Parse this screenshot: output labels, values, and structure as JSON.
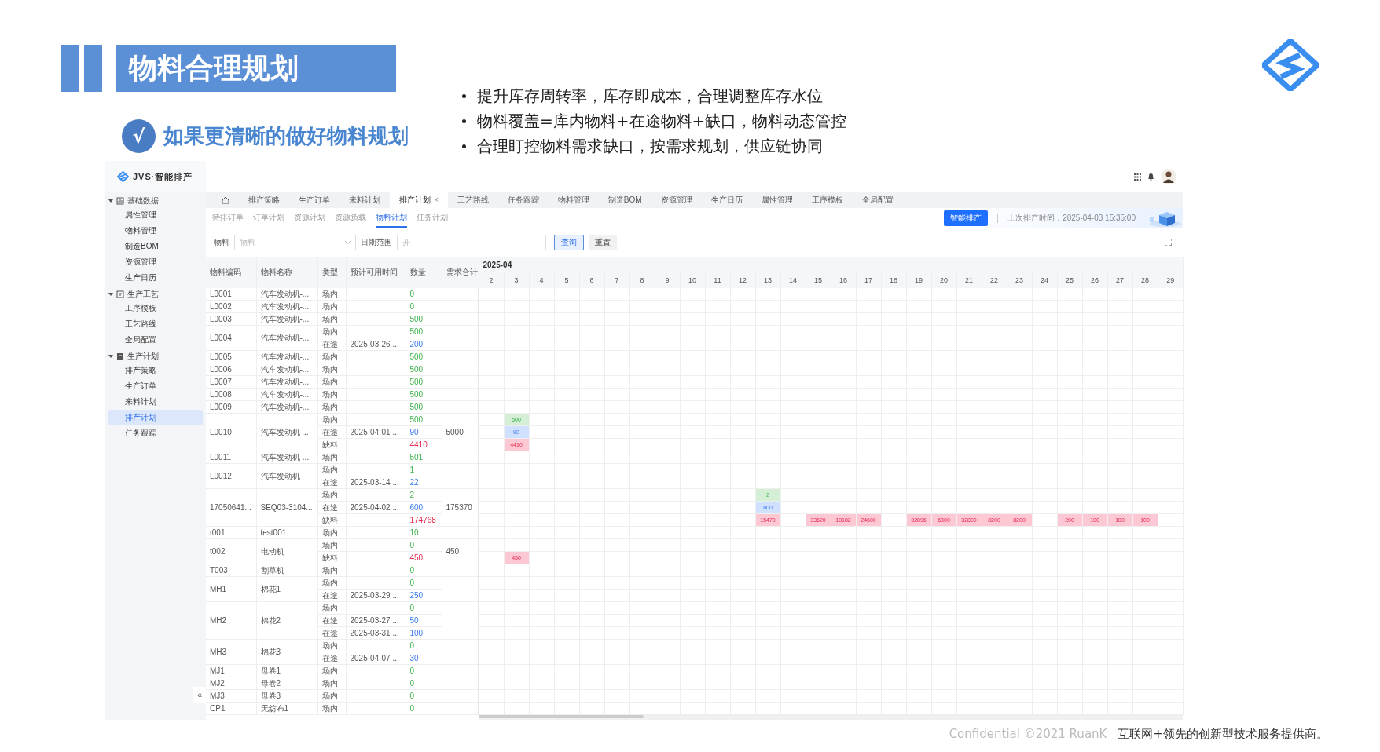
{
  "slide": {
    "title": "物料合理规划",
    "check": "√",
    "subtitle": "如果更清晰的做好物料规划",
    "bullets": [
      "提升库存周转率，库存即成本，合理调整库存水位",
      "物料覆盖=库内物料+在途物料+缺口，物料动态管控",
      "合理盯控物料需求缺口，按需求规划，供应链协同"
    ],
    "footer": {
      "confidential": "Confidential ©2021 RuanK",
      "tagline": "互联网+领先的创新型技术服务提供商。"
    }
  },
  "app": {
    "sidebar": {
      "brand": "JVS·智能排产",
      "collapse": "«",
      "groups": [
        {
          "label": "基础数据",
          "expanded": true,
          "items": [
            {
              "label": "属性管理",
              "selected": false
            },
            {
              "label": "物料管理",
              "selected": false
            },
            {
              "label": "制造BOM",
              "selected": false
            },
            {
              "label": "资源管理",
              "selected": false
            },
            {
              "label": "生产日历",
              "selected": false
            }
          ]
        },
        {
          "label": "生产工艺",
          "expanded": true,
          "items": [
            {
              "label": "工序模板",
              "selected": false
            },
            {
              "label": "工艺路线",
              "selected": false
            },
            {
              "label": "全局配置",
              "selected": false
            }
          ]
        },
        {
          "label": "生产计划",
          "expanded": true,
          "items": [
            {
              "label": "排产策略",
              "selected": false
            },
            {
              "label": "生产订单",
              "selected": false
            },
            {
              "label": "来料计划",
              "selected": false
            },
            {
              "label": "排产计划",
              "selected": true
            },
            {
              "label": "任务跟踪",
              "selected": false
            }
          ]
        }
      ]
    },
    "tabs": [
      {
        "label": "排产策略",
        "selected": false
      },
      {
        "label": "生产订单",
        "selected": false
      },
      {
        "label": "来料计划",
        "selected": false
      },
      {
        "label": "排产计划",
        "selected": true,
        "close": "×"
      },
      {
        "label": "工艺路线",
        "selected": false
      },
      {
        "label": "任务跟踪",
        "selected": false
      },
      {
        "label": "物料管理",
        "selected": false
      },
      {
        "label": "制造BOM",
        "selected": false
      },
      {
        "label": "资源管理",
        "selected": false
      },
      {
        "label": "生产日历",
        "selected": false
      },
      {
        "label": "属性管理",
        "selected": false
      },
      {
        "label": "工序模板",
        "selected": false
      },
      {
        "label": "全局配置",
        "selected": false
      }
    ],
    "subtabs": [
      {
        "label": "待排订单",
        "selected": false
      },
      {
        "label": "订单计划",
        "selected": false
      },
      {
        "label": "资源计划",
        "selected": false
      },
      {
        "label": "资源负载",
        "selected": false
      },
      {
        "label": "物料计划",
        "selected": true
      },
      {
        "label": "任务计划",
        "selected": false
      }
    ],
    "action_button": "智能排产",
    "last_run": "上次排产时间：2025-04-03 15:35:00",
    "filters": {
      "material_label": "物料",
      "material_placeholder": "物料",
      "date_label": "日期范围",
      "date_placeholder": "开",
      "date_separator": "-",
      "query_button": "查询",
      "reset_button": "重置"
    },
    "table": {
      "columns": [
        "物料编码",
        "物料名称",
        "类型",
        "预计可用时间",
        "数量",
        "需求合计"
      ],
      "month": "2025-04",
      "days": [
        "2",
        "3",
        "4",
        "5",
        "6",
        "7",
        "8",
        "9",
        "10",
        "11",
        "12",
        "13",
        "14",
        "15",
        "16",
        "17",
        "18",
        "19",
        "20",
        "21",
        "22",
        "23",
        "24",
        "25",
        "26",
        "27",
        "28",
        "29"
      ],
      "rows": [
        {
          "code": "L0001",
          "name": "汽车发动机-...",
          "entries": [
            {
              "type": "场内",
              "kind": "onsite",
              "qty": "0"
            }
          ]
        },
        {
          "code": "L0002",
          "name": "汽车发动机-...",
          "entries": [
            {
              "type": "场内",
              "kind": "onsite",
              "qty": "0"
            }
          ]
        },
        {
          "code": "L0003",
          "name": "汽车发动机-...",
          "entries": [
            {
              "type": "场内",
              "kind": "onsite",
              "qty": "500"
            }
          ]
        },
        {
          "code": "L0004",
          "name": "汽车发动机-...",
          "entries": [
            {
              "type": "场内",
              "kind": "onsite",
              "qty": "500"
            },
            {
              "type": "在途",
              "kind": "transit",
              "time": "2025-03-26 ...",
              "qty": "200"
            }
          ]
        },
        {
          "code": "L0005",
          "name": "汽车发动机-...",
          "entries": [
            {
              "type": "场内",
              "kind": "onsite",
              "qty": "500"
            }
          ]
        },
        {
          "code": "L0006",
          "name": "汽车发动机-...",
          "entries": [
            {
              "type": "场内",
              "kind": "onsite",
              "qty": "500"
            }
          ]
        },
        {
          "code": "L0007",
          "name": "汽车发动机-...",
          "entries": [
            {
              "type": "场内",
              "kind": "onsite",
              "qty": "500"
            }
          ]
        },
        {
          "code": "L0008",
          "name": "汽车发动机-...",
          "entries": [
            {
              "type": "场内",
              "kind": "onsite",
              "qty": "500"
            }
          ]
        },
        {
          "code": "L0009",
          "name": "汽车发动机-...",
          "entries": [
            {
              "type": "场内",
              "kind": "onsite",
              "qty": "500"
            }
          ]
        },
        {
          "code": "L0010",
          "name": "汽车发动机 ...",
          "demand": "5000",
          "entries": [
            {
              "type": "场内",
              "kind": "onsite",
              "qty": "500",
              "cells": [
                null,
                "500",
                null,
                null,
                null,
                null,
                null,
                null,
                null,
                null,
                null,
                null,
                null,
                null,
                null,
                null,
                null,
                null,
                null,
                null,
                null,
                null,
                null,
                null,
                null,
                null,
                null,
                null
              ]
            },
            {
              "type": "在途",
              "kind": "transit",
              "time": "2025-04-01 ...",
              "qty": "90",
              "cells": [
                null,
                "90",
                null,
                null,
                null,
                null,
                null,
                null,
                null,
                null,
                null,
                null,
                null,
                null,
                null,
                null,
                null,
                null,
                null,
                null,
                null,
                null,
                null,
                null,
                null,
                null,
                null,
                null
              ]
            },
            {
              "type": "缺料",
              "kind": "shortage",
              "qty": "4410",
              "cells": [
                null,
                "4410",
                null,
                null,
                null,
                null,
                null,
                null,
                null,
                null,
                null,
                null,
                null,
                null,
                null,
                null,
                null,
                null,
                null,
                null,
                null,
                null,
                null,
                null,
                null,
                null,
                null,
                null
              ]
            }
          ]
        },
        {
          "code": "L0011",
          "name": "汽车发动机-...",
          "entries": [
            {
              "type": "场内",
              "kind": "onsite",
              "qty": "501"
            }
          ]
        },
        {
          "code": "L0012",
          "name": "汽车发动机",
          "entries": [
            {
              "type": "场内",
              "kind": "onsite",
              "qty": "1"
            },
            {
              "type": "在途",
              "kind": "transit",
              "time": "2025-03-14 ...",
              "qty": "22"
            }
          ]
        },
        {
          "code": "17050641...",
          "name": "SEQ03-3104...",
          "demand": "175370",
          "entries": [
            {
              "type": "场内",
              "kind": "onsite",
              "qty": "2",
              "cells": [
                null,
                null,
                null,
                null,
                null,
                null,
                null,
                null,
                null,
                null,
                null,
                "2",
                null,
                null,
                null,
                null,
                null,
                null,
                null,
                null,
                null,
                null,
                null,
                null,
                null,
                null,
                null,
                null
              ]
            },
            {
              "type": "在途",
              "kind": "transit",
              "time": "2025-04-02 ...",
              "qty": "600",
              "cells": [
                null,
                null,
                null,
                null,
                null,
                null,
                null,
                null,
                null,
                null,
                null,
                "600",
                null,
                null,
                null,
                null,
                null,
                null,
                null,
                null,
                null,
                null,
                null,
                null,
                null,
                null,
                null,
                null
              ]
            },
            {
              "type": "缺料",
              "kind": "shortage",
              "qty": "174768",
              "cells": [
                null,
                null,
                null,
                null,
                null,
                null,
                null,
                null,
                null,
                null,
                null,
                "15470",
                null,
                "33620",
                "10182",
                "24600",
                null,
                "32896",
                "6300",
                "32800",
                "8200",
                "8200",
                null,
                "200",
                "100",
                "100",
                "100",
                null
              ]
            }
          ]
        },
        {
          "code": "t001",
          "name": "test001",
          "entries": [
            {
              "type": "场内",
              "kind": "onsite",
              "qty": "10"
            }
          ]
        },
        {
          "code": "t002",
          "name": "电动机",
          "demand": "450",
          "entries": [
            {
              "type": "场内",
              "kind": "onsite",
              "qty": "0"
            },
            {
              "type": "缺料",
              "kind": "shortage",
              "qty": "450",
              "cells": [
                null,
                "450",
                null,
                null,
                null,
                null,
                null,
                null,
                null,
                null,
                null,
                null,
                null,
                null,
                null,
                null,
                null,
                null,
                null,
                null,
                null,
                null,
                null,
                null,
                null,
                null,
                null,
                null
              ]
            }
          ]
        },
        {
          "code": "T003",
          "name": "割草机",
          "entries": [
            {
              "type": "场内",
              "kind": "onsite",
              "qty": "0"
            }
          ]
        },
        {
          "code": "MH1",
          "name": "棉花1",
          "entries": [
            {
              "type": "场内",
              "kind": "onsite",
              "qty": "0"
            },
            {
              "type": "在途",
              "kind": "transit",
              "time": "2025-03-29 ...",
              "qty": "250"
            }
          ]
        },
        {
          "code": "MH2",
          "name": "棉花2",
          "entries": [
            {
              "type": "场内",
              "kind": "onsite",
              "qty": "0"
            },
            {
              "type": "在途",
              "kind": "transit",
              "time": "2025-03-27 ...",
              "qty": "50"
            },
            {
              "type": "在途",
              "kind": "transit",
              "time": "2025-03-31 ...",
              "qty": "100"
            }
          ]
        },
        {
          "code": "MH3",
          "name": "棉花3",
          "entries": [
            {
              "type": "场内",
              "kind": "onsite",
              "qty": "0"
            },
            {
              "type": "在途",
              "kind": "transit",
              "time": "2025-04-07 ...",
              "qty": "30"
            }
          ]
        },
        {
          "code": "MJ1",
          "name": "母卷1",
          "entries": [
            {
              "type": "场内",
              "kind": "onsite",
              "qty": "0"
            }
          ]
        },
        {
          "code": "MJ2",
          "name": "母卷2",
          "entries": [
            {
              "type": "场内",
              "kind": "onsite",
              "qty": "0"
            }
          ]
        },
        {
          "code": "MJ3",
          "name": "母卷3",
          "entries": [
            {
              "type": "场内",
              "kind": "onsite",
              "qty": "0"
            }
          ]
        },
        {
          "code": "CP1",
          "name": "无纺布1",
          "entries": [
            {
              "type": "场内",
              "kind": "onsite",
              "qty": "0"
            }
          ]
        }
      ]
    }
  }
}
